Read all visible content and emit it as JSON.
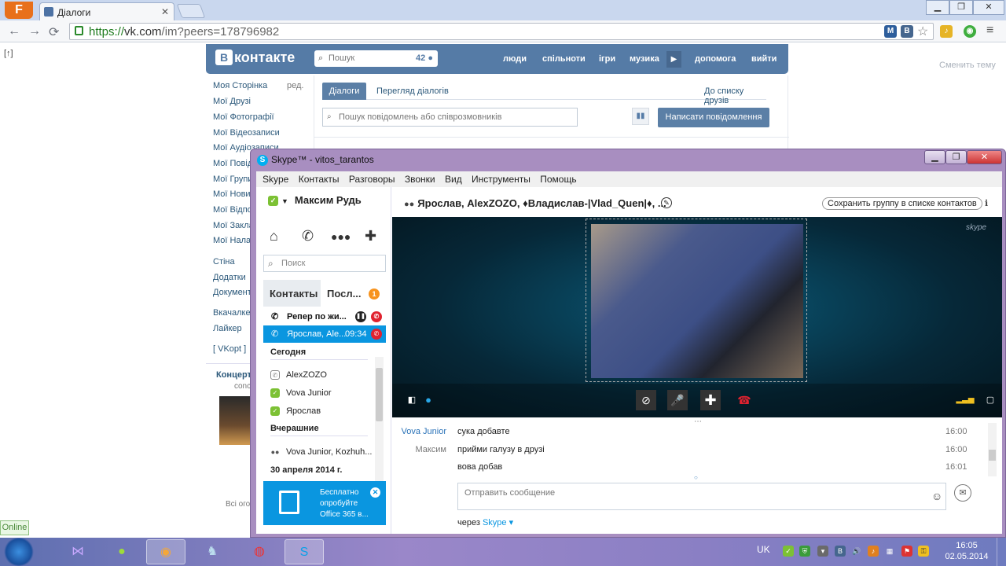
{
  "browser": {
    "badge": "F",
    "tab_title": "Діалоги",
    "url_scheme": "https://",
    "url_host": "vk.com",
    "url_path": "/im?peers=178796982",
    "win_min": "▁",
    "win_max": "❐",
    "win_close": "✕"
  },
  "vk": {
    "page_toggle": "[↑]",
    "change_theme": "Сменить тему",
    "logo": "контакте",
    "logo_badge": "В",
    "search_placeholder": "Пошук",
    "search_count": "42",
    "nav": [
      "люди",
      "спільноти",
      "ігри",
      "музика",
      "допомога",
      "вийти"
    ],
    "left_menu": [
      "Моя Сторінка",
      "Мої Друзі",
      "Мої Фотографії",
      "Мої Відеозаписи",
      "Мої Аудіозаписи",
      "Мої Повід",
      "Мої Групи",
      "Мої Новин",
      "Мої Відпов",
      "Мої Заклад",
      "Мої Налаш",
      "Стіна",
      "Додатки",
      "Документ",
      "Вкачалке",
      "Лайкер",
      "[ VKopt ]"
    ],
    "edit_link": "ред.",
    "promo_title": "Концерт",
    "promo_sub": "conc",
    "promo_lines": [
      "Мако",
      "возвраще",
      "Киев! 17 м",
      "Pla"
    ],
    "promo_link": "Всі огол",
    "tab_dialogs": "Діалоги",
    "tab_browse": "Перегляд діалогів",
    "tab_friends": "До списку друзів",
    "msg_search_placeholder": "Пошук повідомлень або співрозмовників",
    "write_button": "Написати повідомлення"
  },
  "skype": {
    "title": "Skype™ - vitos_tarantos",
    "menu": [
      "Skype",
      "Контакты",
      "Разговоры",
      "Звонки",
      "Вид",
      "Инструменты",
      "Помощь"
    ],
    "user_name": "Максим Рудь",
    "search_placeholder": "Поиск",
    "tab_contacts": "Контакты",
    "tab_recent": "Посл...",
    "recent_badge": "1",
    "active_calls": [
      {
        "name": "Репер по жи..."
      },
      {
        "name": "Ярослав, Ale...",
        "time": "09:34"
      }
    ],
    "groups": [
      {
        "label": "Сегодня"
      },
      {
        "label": "Вчерашние"
      },
      {
        "label": "30 апреля 2014 г."
      }
    ],
    "contacts_today": [
      "AlexZOZO",
      "Vova Junior",
      "Ярослав"
    ],
    "contacts_yesterday": [
      "Vova Junior, Kozhuh..."
    ],
    "office_promo": [
      "Бесплатно",
      "опробуйте",
      "Office 365 в..."
    ],
    "conversation_title": "Ярослав, AlexZOZO, ♦Владислав-|Vlad_Quen|♦, ...",
    "save_group_button": "Сохранить группу в списке контактов",
    "video_watermark": "skype",
    "messages": [
      {
        "sender": "Vova Junior",
        "text": "сука добавте",
        "time": "16:00"
      },
      {
        "sender": "Максим",
        "text": "прийми галузу в друзі",
        "time": "16:00"
      },
      {
        "sender": "",
        "text": "вова добав",
        "time": "16:01"
      }
    ],
    "input_placeholder": "Отправить сообщение",
    "via_label": "через",
    "via_service": "Skype"
  },
  "taskbar": {
    "online_label": "Online",
    "lang": "UK",
    "time": "16:05",
    "date": "02.05.2014"
  },
  "colors": {
    "vk_blue": "#557ba6",
    "skype_blue": "#0a96e0",
    "skype_frame": "#a88ec0",
    "hangup_red": "#e0222f"
  }
}
